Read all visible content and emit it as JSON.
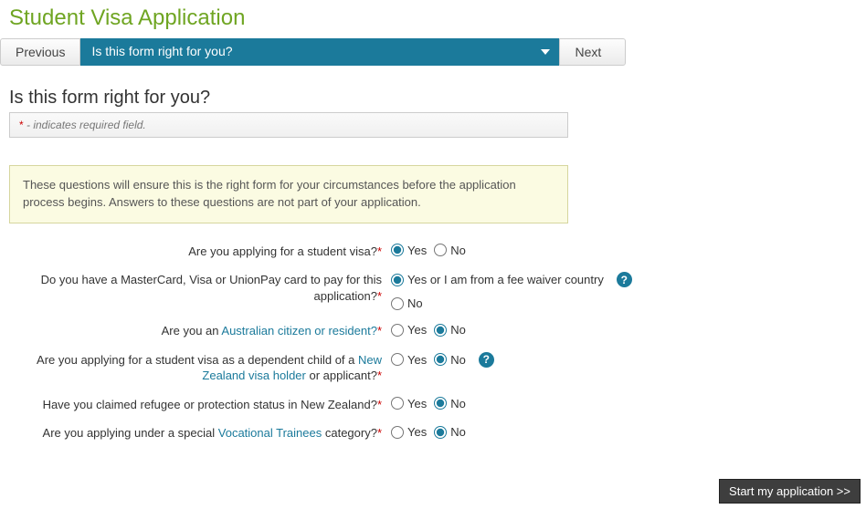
{
  "page_title": "Student Visa Application",
  "nav": {
    "previous_label": "Previous",
    "selector_label": "Is this form right for you?",
    "next_label": "Next"
  },
  "section_title": "Is this form right for you?",
  "required_note_prefix": "*",
  "required_note_text": " - indicates required field.",
  "info_text": "These questions will ensure this is the right form for your circumstances before the application process begins. Answers to these questions are not part of your application.",
  "q1": {
    "label": "Are you applying for a student visa?",
    "yes": "Yes",
    "no": "No",
    "selected": "yes"
  },
  "q2": {
    "label_pre": "Do you have a MasterCard, Visa or UnionPay card to pay for this application?",
    "yes": "Yes or I am from a fee waiver country",
    "no": "No",
    "selected": "yes"
  },
  "q3": {
    "label_pre": "Are you an ",
    "label_link": "Australian citizen or resident?",
    "yes": "Yes",
    "no": "No",
    "selected": "no"
  },
  "q4": {
    "label_pre": "Are you applying for a student visa as a dependent child of a ",
    "label_link": "New Zealand visa holder",
    "label_post": " or applicant?",
    "yes": "Yes",
    "no": "No",
    "selected": "no"
  },
  "q5": {
    "label": "Have you claimed refugee or protection status in New Zealand?",
    "yes": "Yes",
    "no": "No",
    "selected": "no"
  },
  "q6": {
    "label_pre": "Are you applying under a special ",
    "label_link": "Vocational Trainees",
    "label_post": " category?",
    "yes": "Yes",
    "no": "No",
    "selected": "no"
  },
  "start_button": "Start my application >>"
}
